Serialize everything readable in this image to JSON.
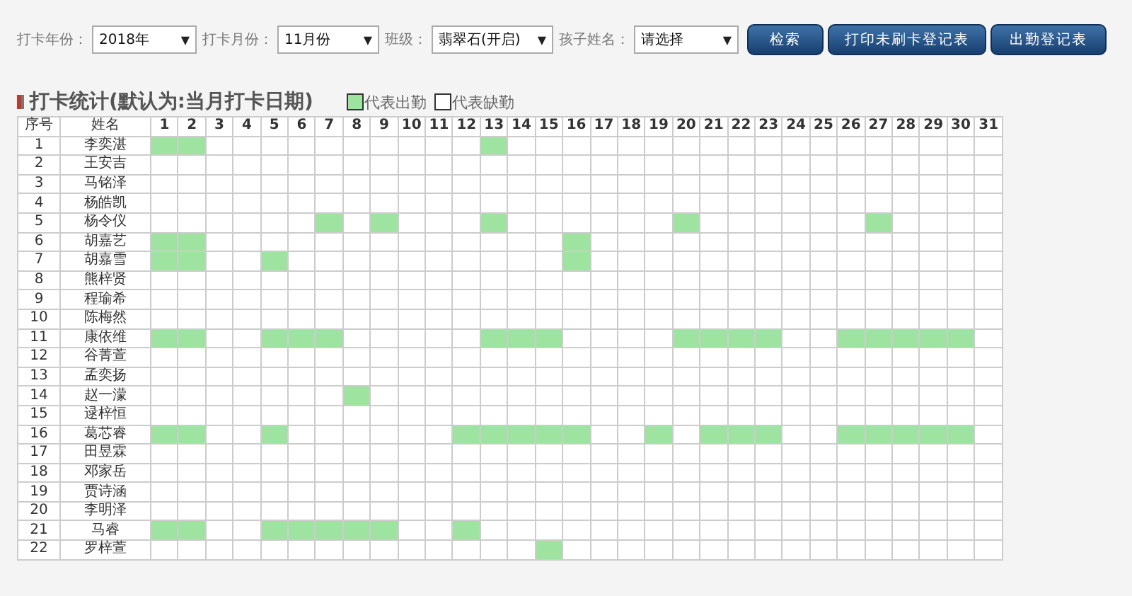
{
  "filters": [
    {
      "label": "打卡年份：",
      "value": "2018年",
      "caret": "▼"
    },
    {
      "label": "打卡月份：",
      "value": "11月份",
      "caret": "▼"
    },
    {
      "label": "班级：",
      "value": "翡翠石(开启)",
      "caret": "▼"
    },
    {
      "label": "孩子姓名：",
      "value": "请选择",
      "caret": "▼"
    }
  ],
  "buttons": [
    "检索",
    "打印未刷卡登记表",
    "出勤登记表"
  ],
  "section": {
    "title": "打卡统计(默认为:当月打卡日期)",
    "legend": [
      {
        "label": "代表出勤",
        "present": true
      },
      {
        "label": "代表缺勤",
        "present": false
      }
    ]
  },
  "table": {
    "columns": [
      "序号",
      "姓名",
      "1",
      "2",
      "3",
      "4",
      "5",
      "6",
      "7",
      "8",
      "9",
      "10",
      "11",
      "12",
      "13",
      "14",
      "15",
      "16",
      "17",
      "18",
      "19",
      "20",
      "21",
      "22",
      "23",
      "24",
      "25",
      "26",
      "27",
      "28",
      "29",
      "30",
      "31"
    ],
    "rows": [
      {
        "no": "1",
        "name": "李奕湛",
        "present": [
          true,
          true,
          false,
          false,
          false,
          false,
          false,
          false,
          false,
          false,
          false,
          false,
          true,
          false,
          false,
          false,
          false,
          false,
          false,
          false,
          false,
          false,
          false,
          false,
          false,
          false,
          false,
          false,
          false,
          false,
          false
        ]
      },
      {
        "no": "2",
        "name": "王安吉",
        "present": [
          false,
          false,
          false,
          false,
          false,
          false,
          false,
          false,
          false,
          false,
          false,
          false,
          false,
          false,
          false,
          false,
          false,
          false,
          false,
          false,
          false,
          false,
          false,
          false,
          false,
          false,
          false,
          false,
          false,
          false,
          false
        ]
      },
      {
        "no": "3",
        "name": "马铭泽",
        "present": [
          false,
          false,
          false,
          false,
          false,
          false,
          false,
          false,
          false,
          false,
          false,
          false,
          false,
          false,
          false,
          false,
          false,
          false,
          false,
          false,
          false,
          false,
          false,
          false,
          false,
          false,
          false,
          false,
          false,
          false,
          false
        ]
      },
      {
        "no": "4",
        "name": "杨皓凯",
        "present": [
          false,
          false,
          false,
          false,
          false,
          false,
          false,
          false,
          false,
          false,
          false,
          false,
          false,
          false,
          false,
          false,
          false,
          false,
          false,
          false,
          false,
          false,
          false,
          false,
          false,
          false,
          false,
          false,
          false,
          false,
          false
        ]
      },
      {
        "no": "5",
        "name": "杨令仪",
        "present": [
          false,
          false,
          false,
          false,
          false,
          false,
          true,
          false,
          true,
          false,
          false,
          false,
          true,
          false,
          false,
          false,
          false,
          false,
          false,
          true,
          false,
          false,
          false,
          false,
          false,
          false,
          true,
          false,
          false,
          false,
          false
        ]
      },
      {
        "no": "6",
        "name": "胡嘉艺",
        "present": [
          true,
          true,
          false,
          false,
          false,
          false,
          false,
          false,
          false,
          false,
          false,
          false,
          false,
          false,
          false,
          true,
          false,
          false,
          false,
          false,
          false,
          false,
          false,
          false,
          false,
          false,
          false,
          false,
          false,
          false,
          false
        ]
      },
      {
        "no": "7",
        "name": "胡嘉雪",
        "present": [
          true,
          true,
          false,
          false,
          true,
          false,
          false,
          false,
          false,
          false,
          false,
          false,
          false,
          false,
          false,
          true,
          false,
          false,
          false,
          false,
          false,
          false,
          false,
          false,
          false,
          false,
          false,
          false,
          false,
          false,
          false
        ]
      },
      {
        "no": "8",
        "name": "熊梓贤",
        "present": [
          false,
          false,
          false,
          false,
          false,
          false,
          false,
          false,
          false,
          false,
          false,
          false,
          false,
          false,
          false,
          false,
          false,
          false,
          false,
          false,
          false,
          false,
          false,
          false,
          false,
          false,
          false,
          false,
          false,
          false,
          false
        ]
      },
      {
        "no": "9",
        "name": "程瑜希",
        "present": [
          false,
          false,
          false,
          false,
          false,
          false,
          false,
          false,
          false,
          false,
          false,
          false,
          false,
          false,
          false,
          false,
          false,
          false,
          false,
          false,
          false,
          false,
          false,
          false,
          false,
          false,
          false,
          false,
          false,
          false,
          false
        ]
      },
      {
        "no": "10",
        "name": "陈梅然",
        "present": [
          false,
          false,
          false,
          false,
          false,
          false,
          false,
          false,
          false,
          false,
          false,
          false,
          false,
          false,
          false,
          false,
          false,
          false,
          false,
          false,
          false,
          false,
          false,
          false,
          false,
          false,
          false,
          false,
          false,
          false,
          false
        ]
      },
      {
        "no": "11",
        "name": "康依维",
        "present": [
          true,
          true,
          false,
          false,
          true,
          true,
          true,
          false,
          false,
          false,
          false,
          false,
          true,
          true,
          true,
          false,
          false,
          false,
          false,
          true,
          true,
          true,
          true,
          false,
          false,
          true,
          true,
          true,
          true,
          true,
          false
        ]
      },
      {
        "no": "12",
        "name": "谷菁萱",
        "present": [
          false,
          false,
          false,
          false,
          false,
          false,
          false,
          false,
          false,
          false,
          false,
          false,
          false,
          false,
          false,
          false,
          false,
          false,
          false,
          false,
          false,
          false,
          false,
          false,
          false,
          false,
          false,
          false,
          false,
          false,
          false
        ]
      },
      {
        "no": "13",
        "name": "孟奕扬",
        "present": [
          false,
          false,
          false,
          false,
          false,
          false,
          false,
          false,
          false,
          false,
          false,
          false,
          false,
          false,
          false,
          false,
          false,
          false,
          false,
          false,
          false,
          false,
          false,
          false,
          false,
          false,
          false,
          false,
          false,
          false,
          false
        ]
      },
      {
        "no": "14",
        "name": "赵一濛",
        "present": [
          false,
          false,
          false,
          false,
          false,
          false,
          false,
          true,
          false,
          false,
          false,
          false,
          false,
          false,
          false,
          false,
          false,
          false,
          false,
          false,
          false,
          false,
          false,
          false,
          false,
          false,
          false,
          false,
          false,
          false,
          false
        ]
      },
      {
        "no": "15",
        "name": "逯梓恒",
        "present": [
          false,
          false,
          false,
          false,
          false,
          false,
          false,
          false,
          false,
          false,
          false,
          false,
          false,
          false,
          false,
          false,
          false,
          false,
          false,
          false,
          false,
          false,
          false,
          false,
          false,
          false,
          false,
          false,
          false,
          false,
          false
        ]
      },
      {
        "no": "16",
        "name": "葛芯睿",
        "present": [
          true,
          true,
          false,
          false,
          true,
          false,
          false,
          false,
          false,
          false,
          false,
          true,
          true,
          true,
          true,
          true,
          false,
          false,
          true,
          false,
          true,
          true,
          true,
          false,
          false,
          true,
          true,
          true,
          true,
          true,
          false
        ]
      },
      {
        "no": "17",
        "name": "田昱霖",
        "present": [
          false,
          false,
          false,
          false,
          false,
          false,
          false,
          false,
          false,
          false,
          false,
          false,
          false,
          false,
          false,
          false,
          false,
          false,
          false,
          false,
          false,
          false,
          false,
          false,
          false,
          false,
          false,
          false,
          false,
          false,
          false
        ]
      },
      {
        "no": "18",
        "name": "邓家岳",
        "present": [
          false,
          false,
          false,
          false,
          false,
          false,
          false,
          false,
          false,
          false,
          false,
          false,
          false,
          false,
          false,
          false,
          false,
          false,
          false,
          false,
          false,
          false,
          false,
          false,
          false,
          false,
          false,
          false,
          false,
          false,
          false
        ]
      },
      {
        "no": "19",
        "name": "贾诗涵",
        "present": [
          false,
          false,
          false,
          false,
          false,
          false,
          false,
          false,
          false,
          false,
          false,
          false,
          false,
          false,
          false,
          false,
          false,
          false,
          false,
          false,
          false,
          false,
          false,
          false,
          false,
          false,
          false,
          false,
          false,
          false,
          false
        ]
      },
      {
        "no": "20",
        "name": "李明泽",
        "present": [
          false,
          false,
          false,
          false,
          false,
          false,
          false,
          false,
          false,
          false,
          false,
          false,
          false,
          false,
          false,
          false,
          false,
          false,
          false,
          false,
          false,
          false,
          false,
          false,
          false,
          false,
          false,
          false,
          false,
          false,
          false
        ]
      },
      {
        "no": "21",
        "name": "马睿",
        "present": [
          true,
          true,
          false,
          false,
          true,
          true,
          true,
          true,
          true,
          false,
          false,
          true,
          false,
          false,
          false,
          false,
          false,
          false,
          false,
          false,
          false,
          false,
          false,
          false,
          false,
          false,
          false,
          false,
          false,
          false,
          false
        ]
      },
      {
        "no": "22",
        "name": "罗梓萱",
        "present": [
          false,
          false,
          false,
          false,
          false,
          false,
          false,
          false,
          false,
          false,
          false,
          false,
          false,
          false,
          true,
          false,
          false,
          false,
          false,
          false,
          false,
          false,
          false,
          false,
          false,
          false,
          false,
          false,
          false,
          false,
          false
        ]
      }
    ]
  }
}
